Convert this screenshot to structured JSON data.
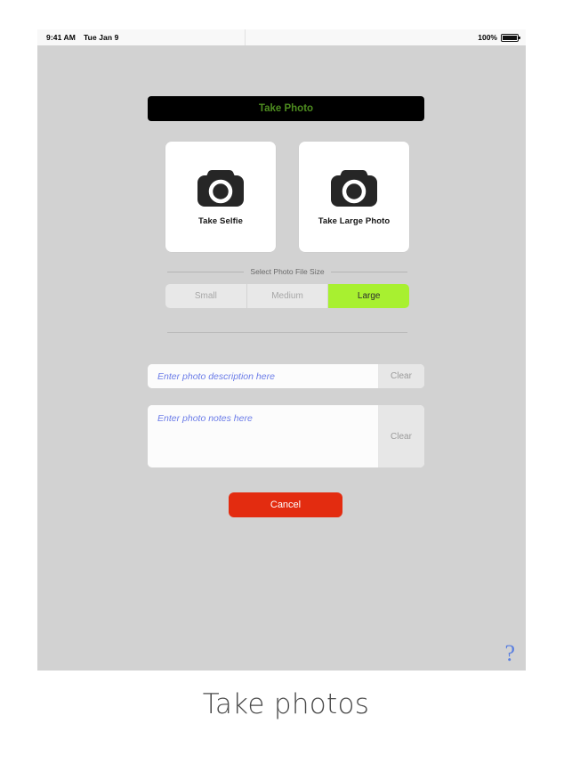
{
  "statusbar": {
    "time": "9:41 AM",
    "date": "Tue Jan 9",
    "battery_percent": "100%",
    "battery_icon": "battery-full-icon"
  },
  "header": {
    "title": "Take Photo"
  },
  "photo_buttons": [
    {
      "label": "Take Selfie",
      "icon": "camera-icon"
    },
    {
      "label": "Take Large Photo",
      "icon": "camera-icon"
    }
  ],
  "file_size_section": {
    "divider_label": "Select Photo File Size",
    "options": [
      {
        "label": "Small",
        "selected": false
      },
      {
        "label": "Medium",
        "selected": false
      },
      {
        "label": "Large",
        "selected": true
      }
    ]
  },
  "description_field": {
    "value": "",
    "placeholder": "Enter photo description here",
    "clear_label": "Clear"
  },
  "notes_field": {
    "value": "",
    "placeholder": "Enter photo notes here",
    "clear_label": "Clear"
  },
  "cancel_button": {
    "label": "Cancel"
  },
  "help": {
    "glyph": "?",
    "icon": "help-question-icon"
  },
  "caption": {
    "text": "Take photos"
  },
  "colors": {
    "accent_green": "#a8f030",
    "header_text_green": "#4d8c1f",
    "cancel_red": "#e32c10",
    "placeholder_blue": "#6b7ce8",
    "screen_background": "#d2d2d2",
    "help_blue": "#5a7fe0"
  }
}
